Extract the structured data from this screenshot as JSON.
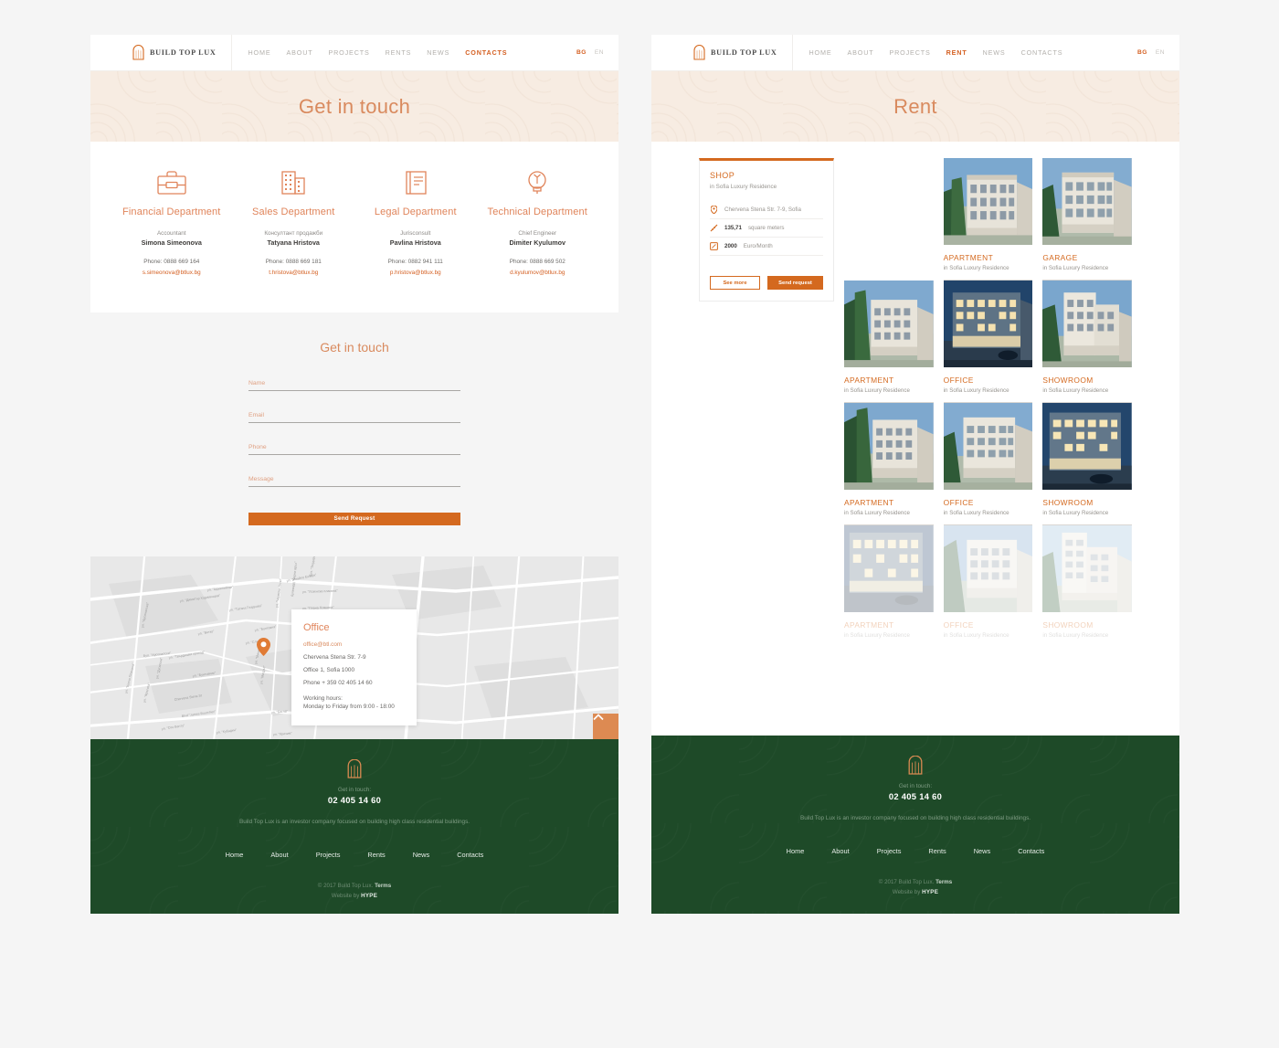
{
  "brand": {
    "name": "BUILD TOP LUX",
    "logo_color": "#d4691f"
  },
  "colors": {
    "accent": "#d4691f",
    "accent_light": "#e0845a",
    "hero_bg": "#f7ece2",
    "footer_bg": "#1e4a28"
  },
  "contacts_page": {
    "nav": {
      "links": [
        {
          "label": "HOME",
          "active": false
        },
        {
          "label": "ABOUT",
          "active": false
        },
        {
          "label": "PROJECTS",
          "active": false
        },
        {
          "label": "RENTS",
          "active": false
        },
        {
          "label": "NEWS",
          "active": false
        },
        {
          "label": "CONTACTS",
          "active": true
        }
      ],
      "languages": [
        {
          "label": "BG",
          "active": true
        },
        {
          "label": "EN",
          "active": false
        }
      ]
    },
    "hero_title": "Get in touch",
    "departments": [
      {
        "icon": "briefcase-icon",
        "title": "Financial Department",
        "role": "Accountant",
        "name": "Simona Simeonova",
        "phone": "Phone: 0888 669 164",
        "email": "s.simeonova@btlux.bg"
      },
      {
        "icon": "building-icon",
        "title": "Sales Department",
        "role": "Консултант продажби",
        "name": "Tatyana Hristova",
        "phone": "Phone: 0888 669 181",
        "email": "t.hristova@btlux.bg"
      },
      {
        "icon": "book-icon",
        "title": "Legal Department",
        "role": "Jurisconsult",
        "name": "Pavlina Hristova",
        "phone": "Phone: 0882 941 111",
        "email": "p.hristova@btlux.bg"
      },
      {
        "icon": "lightbulb-icon",
        "title": "Technical Department",
        "role": "Chief Engineer",
        "name": "Dimiter Kyulumov",
        "phone": "Phone: 0888 669 502",
        "email": "d.kyulumov@btlux.bg"
      }
    ],
    "form": {
      "title": "Get in touch",
      "fields": [
        {
          "name": "name",
          "placeholder": "Name",
          "value": ""
        },
        {
          "name": "email",
          "placeholder": "Email",
          "value": ""
        },
        {
          "name": "phone",
          "placeholder": "Phone",
          "value": ""
        },
        {
          "name": "message",
          "placeholder": "Message",
          "value": ""
        }
      ],
      "submit_label": "Send Request"
    },
    "map_card": {
      "title": "Office",
      "email": "office@btl.com",
      "address_line1": "Chervena Stena Str. 7-9",
      "address_line2": "Office 1, Sofia 1000",
      "phone": "Phone + 359 02 405 14 60",
      "hours_label": "Working hours:",
      "hours_value": "Monday to Friday from 9:00 - 18:00"
    }
  },
  "rent_page": {
    "nav": {
      "links": [
        {
          "label": "HOME",
          "active": false
        },
        {
          "label": "ABOUT",
          "active": false
        },
        {
          "label": "PROJECTS",
          "active": false
        },
        {
          "label": "RENT",
          "active": true
        },
        {
          "label": "NEWS",
          "active": false
        },
        {
          "label": "CONTACTS",
          "active": false
        }
      ],
      "languages": [
        {
          "label": "BG",
          "active": true
        },
        {
          "label": "EN",
          "active": false
        }
      ]
    },
    "hero_title": "Rent",
    "shop_card": {
      "title": "SHOP",
      "subtitle": "in Sofia Luxury Residence",
      "rows": [
        {
          "icon": "location-pin-icon",
          "strong": "",
          "text": "Chervena Stena Str. 7-9, Sofia"
        },
        {
          "icon": "ruler-icon",
          "strong": "135,71",
          "text": "square meters"
        },
        {
          "icon": "price-tag-icon",
          "strong": "2000",
          "text": "Euro/Month"
        }
      ],
      "see_more_label": "See more",
      "send_request_label": "Send request"
    },
    "listings": [
      {
        "title": "APARTMENT",
        "subtitle": "in Sofia Luxury Residence",
        "variant": "day",
        "fade": false,
        "blank": false
      },
      {
        "title": "GARAGE",
        "subtitle": "in Sofia Luxury Residence",
        "variant": "day",
        "fade": false,
        "blank": false
      },
      {
        "title": "APARTMENT",
        "subtitle": "in Sofia Luxury Residence",
        "variant": "trees",
        "fade": false,
        "blank": false
      },
      {
        "title": "OFFICE",
        "subtitle": "in Sofia Luxury Residence",
        "variant": "night",
        "fade": false,
        "blank": false
      },
      {
        "title": "SHOWROOM",
        "subtitle": "in Sofia Luxury Residence",
        "variant": "day",
        "fade": false,
        "blank": false
      },
      {
        "title": "APARTMENT",
        "subtitle": "in Sofia Luxury Residence",
        "variant": "trees",
        "fade": false,
        "blank": false
      },
      {
        "title": "OFFICE",
        "subtitle": "in Sofia Luxury Residence",
        "variant": "day",
        "fade": false,
        "blank": false
      },
      {
        "title": "SHOWROOM",
        "subtitle": "in Sofia Luxury Residence",
        "variant": "night",
        "fade": false,
        "blank": false
      },
      {
        "title": "APARTMENT",
        "subtitle": "in Sofia Luxury Residence",
        "variant": "night",
        "fade": true,
        "blank": false
      },
      {
        "title": "OFFICE",
        "subtitle": "in Sofia Luxury Residence",
        "variant": "day",
        "fade": true,
        "blank": false
      },
      {
        "title": "SHOWROOM",
        "subtitle": "in Sofia Luxury Residence",
        "variant": "day",
        "fade": true,
        "blank": false
      }
    ]
  },
  "footer": {
    "touch_label": "Get in touch:",
    "phone": "02 405 14 60",
    "description": "Build Top Lux is an investor company focused on building high class residential buildings.",
    "nav": [
      "Home",
      "About",
      "Projects",
      "Rents",
      "News",
      "Contacts"
    ],
    "copyright_prefix": "© 2017 Build Top Lux.",
    "copyright_terms": "Terms",
    "website_by_prefix": "Website by",
    "website_by_name": "HYPE"
  }
}
